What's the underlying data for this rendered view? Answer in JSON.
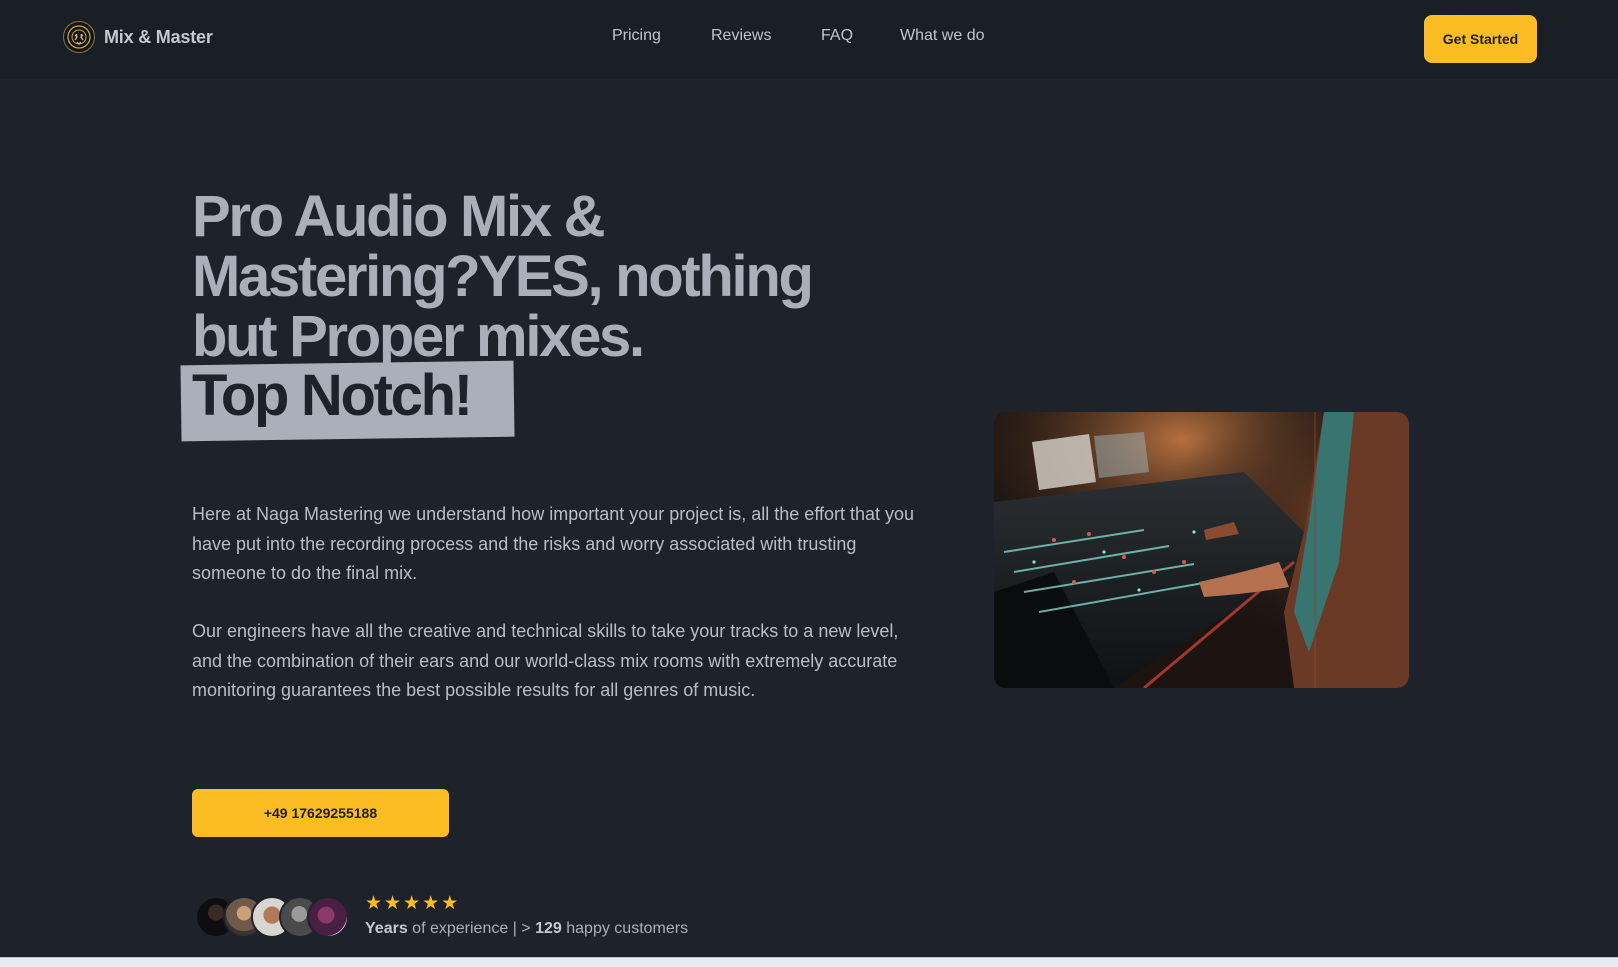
{
  "header": {
    "brand_name": "Mix & Master",
    "nav": [
      {
        "label": "Pricing"
      },
      {
        "label": "Reviews"
      },
      {
        "label": "FAQ"
      },
      {
        "label": "What we do"
      }
    ],
    "cta_label": "Get Started"
  },
  "hero": {
    "headline_lines": [
      "Pro Audio Mix &",
      "Mastering?YES, nothing",
      "but Proper mixes."
    ],
    "highlight": "Top Notch!",
    "paragraphs": [
      "Here at Naga Mastering we understand how important your project is, all the effort that you have put into the recording process and the risks and worry associated with trusting someone to do the final mix.",
      "Our engineers have all the creative and technical skills to take your tracks to a new level, and the combination of their ears and our world-class mix rooms with extremely accurate monitoring guarantees the best possible results for all genres of music."
    ],
    "phone_button": "+49 17629255188",
    "photo_icon": "mixing-console-photo"
  },
  "social_proof": {
    "rating": 5,
    "star_icon": "star-icon",
    "years_label": "Years",
    "of_experience": "of experience",
    "separator": "| >",
    "customer_count": "129",
    "customers_label": "happy customers"
  },
  "colors": {
    "background": "#1e232b",
    "header_background": "#1a1f26",
    "accent": "#fbbd23",
    "headline": "#a9b0ba",
    "body_text": "#b8bec7"
  }
}
